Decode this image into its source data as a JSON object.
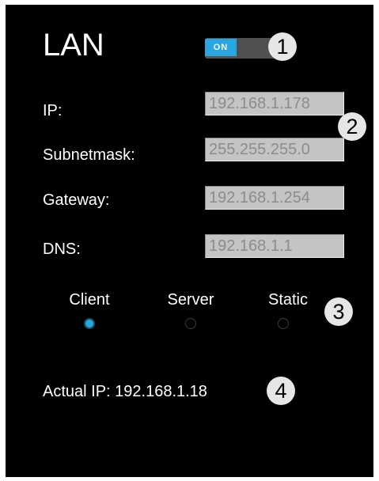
{
  "lan": {
    "title": "LAN",
    "toggle_label": "ON",
    "toggle_state": "on"
  },
  "fields": [
    {
      "label": "IP:",
      "value": "192.168.1.178"
    },
    {
      "label": "Subnetmask:",
      "value": "255.255.255.0"
    },
    {
      "label": "Gateway:",
      "value": "192.168.1.254"
    },
    {
      "label": "DNS:",
      "value": "192.168.1.1"
    }
  ],
  "modes": [
    {
      "label": "Client",
      "selected": true
    },
    {
      "label": "Server",
      "selected": false
    },
    {
      "label": "Static",
      "selected": false
    }
  ],
  "actual_ip": "Actual IP: 192.168.1.18",
  "callouts": [
    "1",
    "2",
    "3",
    "4"
  ],
  "colors": {
    "accent": "#29a7e1",
    "panel_background": "#000000",
    "field_background": "#c4c4c4",
    "field_text": "#8c8c8c"
  }
}
